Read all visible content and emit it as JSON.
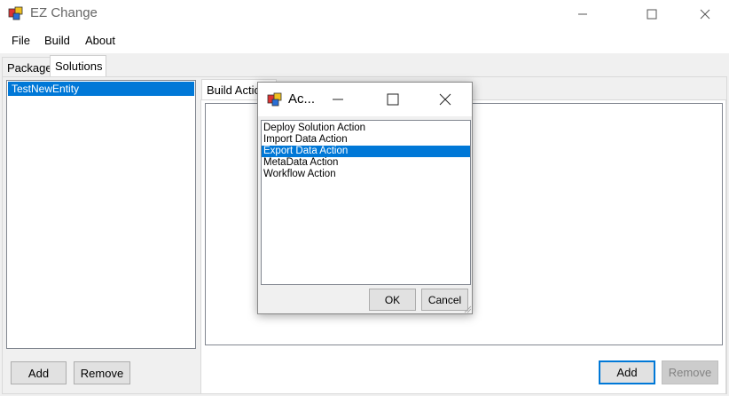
{
  "window": {
    "title": "EZ Change"
  },
  "menu": {
    "items": [
      "File",
      "Build",
      "About"
    ]
  },
  "tabs": {
    "package": "Package",
    "solutions": "Solutions"
  },
  "solutions_list": {
    "items": [
      "TestNewEntity"
    ],
    "selected": 0
  },
  "left_buttons": {
    "add": "Add",
    "remove": "Remove"
  },
  "build_tab": {
    "label": "Build Actio"
  },
  "right_buttons": {
    "add": "Add",
    "remove": "Remove"
  },
  "dialog": {
    "title": "Ac...",
    "items": [
      "Deploy Solution Action",
      "Import Data Action",
      "Export Data Action",
      "MetaData Action",
      "Workflow Action"
    ],
    "selected": 2,
    "ok": "OK",
    "cancel": "Cancel"
  },
  "colors": {
    "selection": "#0078d7",
    "accent_border": "#0078d7"
  }
}
